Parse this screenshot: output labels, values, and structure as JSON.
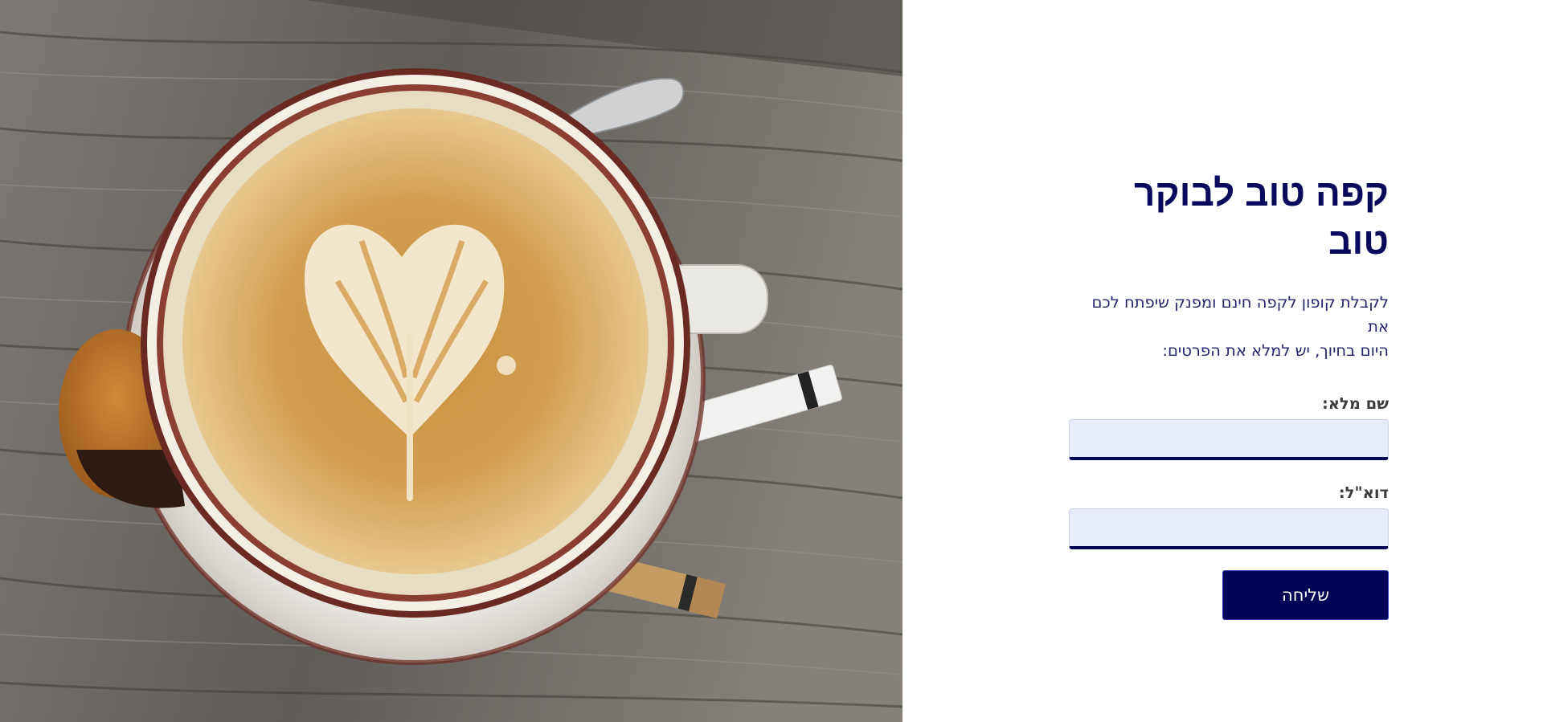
{
  "hero": {
    "image": "coffee-latte-art-photo"
  },
  "form": {
    "title": "קפה טוב לבוקר טוב",
    "intro_line1": "לקבלת קופון לקפה חינם ומפנק שיפתח לכם את",
    "intro_line2": "היום בחיוך, יש למלא את הפרטים:",
    "full_name_label": "שם מלא:",
    "full_name_value": "",
    "email_label": "דוא\"ל:",
    "email_value": "",
    "submit_label": "שליחה"
  },
  "colors": {
    "brand_navy": "#050558",
    "title": "#0a0a5c",
    "input_bg": "#e6ecfb"
  }
}
